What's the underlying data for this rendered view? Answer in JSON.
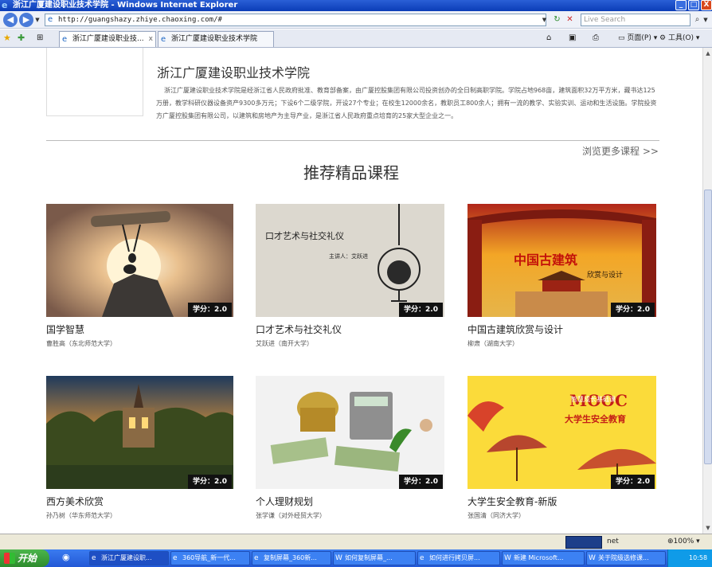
{
  "window": {
    "title": "浙江广厦建设职业技术学院 - Windows Internet Explorer",
    "controls": [
      "_",
      "□",
      "X"
    ]
  },
  "address_bar": {
    "url": "http://guangshazy.zhiye.chaoxing.com/#",
    "search_placeholder": "Live Search"
  },
  "tabs": [
    {
      "label": "浙江广厦建设职业技..."
    },
    {
      "label": "浙江广厦建设职业技术学院"
    }
  ],
  "toolbar": {
    "page_label": "页面(P)",
    "tools_label": "工具(O)"
  },
  "school": {
    "name": "浙江广厦建设职业技术学院",
    "description": "浙江广厦建设职业技术学院是经浙江省人民政府批准、教育部备案，由广厦控股集团有限公司投资创办的全日制高职学院。学院占地968亩，建筑面积32万平方米，藏书达125万册，教学科研仪器设备资产9300多万元；下设6个二级学院，开设27个专业；在校生12000余名，教职员工800余人；拥有一流的教学、实验实训、运动和生活设施。学院投资方广厦控股集团有限公司，以建筑和房地产为主导产业，是浙江省人民政府重点培育的25家大型企业之一。"
  },
  "more_link": "浏览更多课程 >>",
  "section_title": "推荐精品课程",
  "courses": [
    {
      "name": "国学智慧",
      "teacher": "曹胜高（东北师范大学）",
      "credit": "学分：2.0"
    },
    {
      "name": "口才艺术与社交礼仪",
      "teacher": "艾跃进（南开大学）",
      "credit": "学分：2.0",
      "image_text": "口才艺术与社交礼仪",
      "image_sub": "主讲人：艾跃进"
    },
    {
      "name": "中国古建筑欣赏与设计",
      "teacher": "柳肃（湖南大学）",
      "credit": "学分：2.0",
      "image_text": "中国古建筑",
      "image_sub": "欣赏与设计"
    },
    {
      "name": "西方美术欣赏",
      "teacher": "孙乃树（华东师范大学）",
      "credit": "学分：2.0"
    },
    {
      "name": "个人理财规划",
      "teacher": "张学谦（对外经贸大学）",
      "credit": "学分：2.0"
    },
    {
      "name": "大学生安全教育-新版",
      "teacher": "张国清（同济大学）",
      "credit": "学分：2.0",
      "image_title": "MOOC",
      "image_banner": "智慧成长基础课",
      "image_text": "大学生安全教育"
    }
  ],
  "status_bar": {
    "zone_text": "net",
    "zoom": "100%"
  },
  "taskbar": {
    "start_label": "开始",
    "items": [
      {
        "label": "浙江广厦建设职..."
      },
      {
        "label": "360导航_新一代..."
      },
      {
        "label": "复制屏幕_360新..."
      },
      {
        "label": "如何复制屏幕_..."
      },
      {
        "label": "如何进行拷贝屏..."
      },
      {
        "label": "新建 Microsoft..."
      },
      {
        "label": "关于院级选修课..."
      }
    ],
    "clock": "10:58"
  },
  "colors": {
    "title_bar": "#0b3db7",
    "taskbar": "#2258d6",
    "credit_badge": "#111111",
    "divider": "#bbbbbb"
  }
}
